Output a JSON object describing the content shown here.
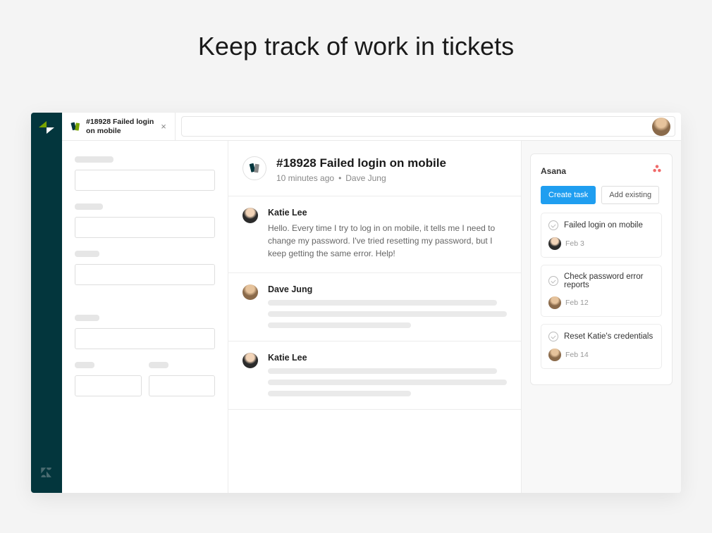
{
  "hero": {
    "title": "Keep track of work in tickets"
  },
  "tab": {
    "title_line1": "#18928 Failed login",
    "title_line2": "on mobile"
  },
  "ticket": {
    "title": "#18928 Failed login on mobile",
    "time": "10 minutes ago",
    "author": "Dave Jung"
  },
  "messages": [
    {
      "author": "Katie Lee",
      "avatarClass": "katie",
      "text": "Hello. Every time I try to log in on mobile, it tells me I need to change my password. I've tried resetting my password, but I keep getting the same error. Help!",
      "placeholder": false
    },
    {
      "author": "Dave Jung",
      "avatarClass": "dave",
      "text": "",
      "placeholder": true
    },
    {
      "author": "Katie Lee",
      "avatarClass": "katie",
      "text": "",
      "placeholder": true
    }
  ],
  "asana": {
    "title": "Asana",
    "create_label": "Create task",
    "add_label": "Add existing",
    "tasks": [
      {
        "title": "Failed login on mobile",
        "date": "Feb 3",
        "avatarClass": "katie"
      },
      {
        "title": "Check password error reports",
        "date": "Feb 12",
        "avatarClass": "dave"
      },
      {
        "title": "Reset Katie's credentials",
        "date": "Feb 14",
        "avatarClass": "dave"
      }
    ]
  }
}
